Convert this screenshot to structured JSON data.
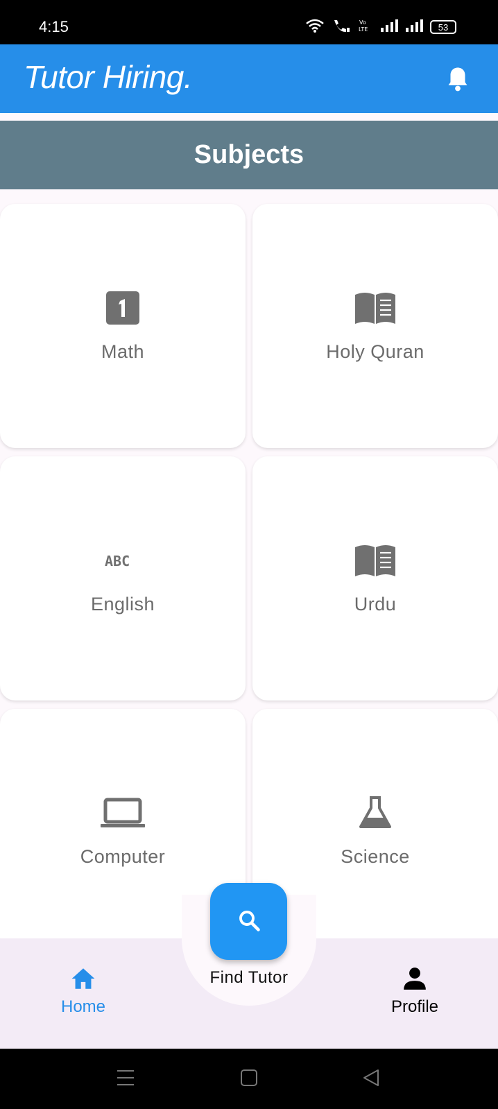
{
  "status_bar": {
    "time": "4:15",
    "battery": "53",
    "icons": [
      "wifi-icon",
      "wifi-call-icon",
      "volte-icon",
      "signal-icon",
      "signal-icon",
      "battery-icon"
    ]
  },
  "app_bar": {
    "title": "Tutor Hiring.",
    "notification_icon": "bell-icon"
  },
  "section": {
    "title": "Subjects"
  },
  "subjects": [
    {
      "label": "Math",
      "icon": "looks-one-icon"
    },
    {
      "label": "Holy Quran",
      "icon": "menu-book-icon"
    },
    {
      "label": "English",
      "icon": "abc-icon"
    },
    {
      "label": "Urdu",
      "icon": "menu-book-icon"
    },
    {
      "label": "Computer",
      "icon": "laptop-icon"
    },
    {
      "label": "Science",
      "icon": "flask-icon"
    }
  ],
  "bottom_nav": {
    "home": "Home",
    "find_tutor": "Find Tutor",
    "profile": "Profile"
  },
  "colors": {
    "primary": "#268ee9",
    "header": "#607d8b",
    "fab": "#2196f3",
    "icon_grey": "#707070",
    "nav_background": "#f3ebf6"
  }
}
